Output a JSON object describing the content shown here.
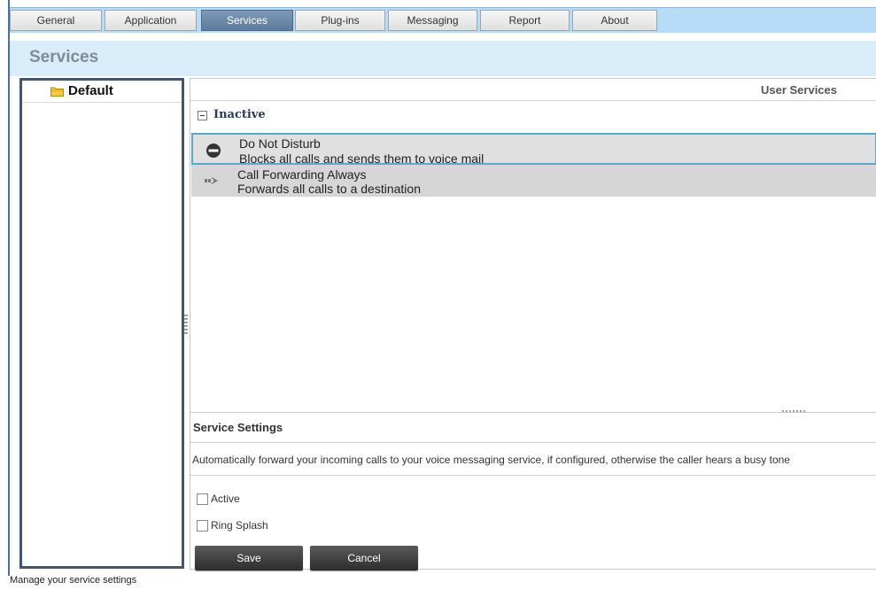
{
  "tabs": [
    {
      "label": "General",
      "active": false
    },
    {
      "label": "Application",
      "active": false
    },
    {
      "label": "Services",
      "active": true
    },
    {
      "label": "Plug-ins",
      "active": false
    },
    {
      "label": "Messaging",
      "active": false
    },
    {
      "label": "Report",
      "active": false
    },
    {
      "label": "About",
      "active": false
    }
  ],
  "page": {
    "title": "Services"
  },
  "tree": {
    "items": [
      {
        "label": "Default",
        "icon": "folder-icon"
      }
    ]
  },
  "user_services": {
    "title": "User Services",
    "group_label": "Inactive",
    "items": [
      {
        "name": "Do Not Disturb",
        "description": "Blocks all calls and sends them to voice mail",
        "icon": "no-entry-icon",
        "selected": true
      },
      {
        "name": "Call Forwarding Always",
        "description": "Forwards all calls to a destination",
        "icon": "forward-arrow-icon",
        "selected": false
      }
    ]
  },
  "settings": {
    "title": "Service Settings",
    "description": "Automatically forward your incoming calls to your voice messaging service, if configured, otherwise the caller hears a busy tone",
    "active_label": "Active",
    "ring_splash_label": "Ring Splash",
    "save_label": "Save",
    "cancel_label": "Cancel"
  },
  "status_text": "Manage your service settings",
  "colors": {
    "tab_bar": "#b8dcf5",
    "header_bg": "#d8ecf9",
    "selected_border": "#58a9c8",
    "button_dark": "#3a3a3a"
  }
}
